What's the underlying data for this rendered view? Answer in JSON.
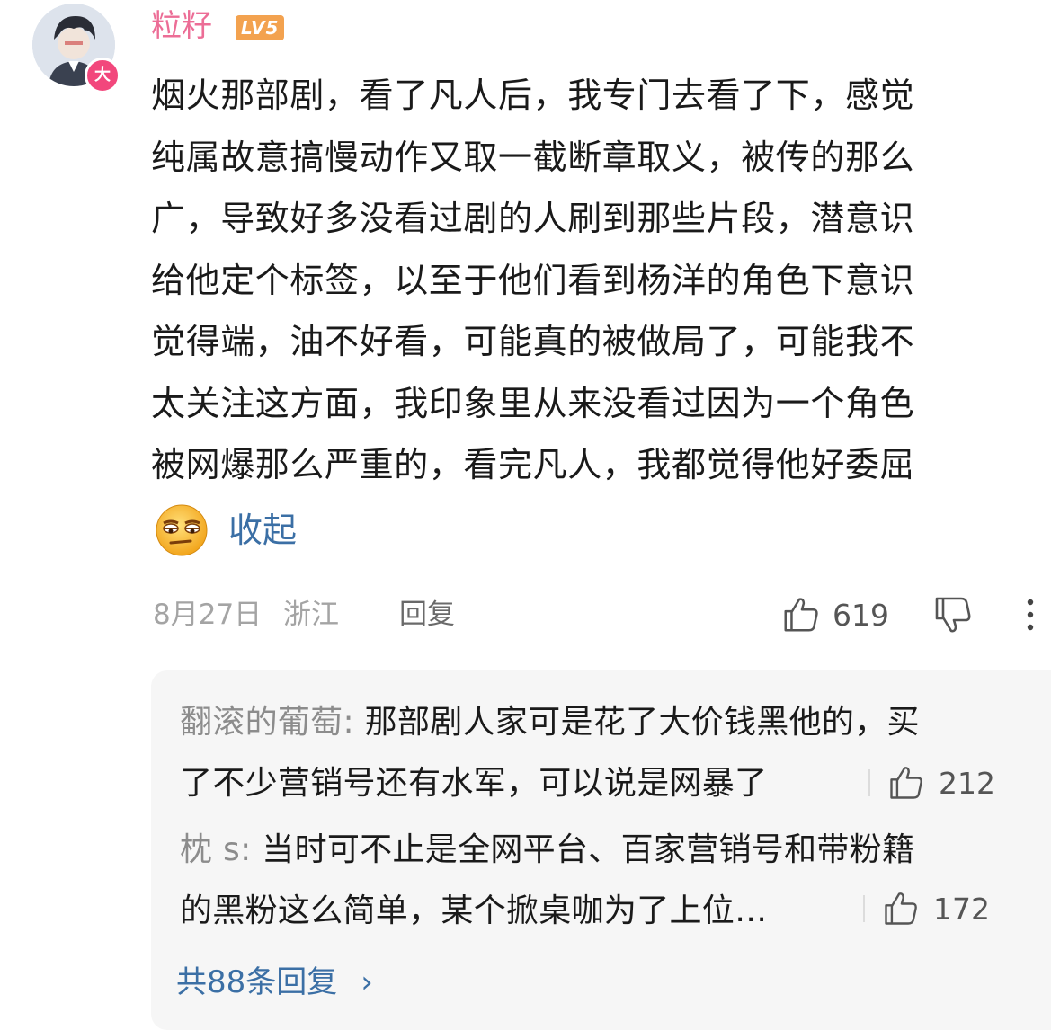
{
  "comment": {
    "username": "粒籽",
    "level": "LV5",
    "vip_badge": "大",
    "lines": [
      "烟火那部剧，看了凡人后，我专门去看了下，感觉",
      "纯属故意搞慢动作又取一截断章取义，被传的那么",
      "广，导致好多没看过剧的人刷到那些片段，潜意识",
      "给他定个标签，以至于他们看到杨洋的角色下意识",
      "觉得端，油不好看，可能真的被做局了，可能我不",
      "太关注这方面，我印象里从来没看过因为一个角色",
      "被网爆那么严重的，看完凡人，我都觉得他好委屈"
    ],
    "emoji": "eye-roll-emoji",
    "collapse_label": "收起",
    "date": "8月27日",
    "location": "浙江",
    "reply_label": "回复",
    "like_count": "619"
  },
  "replies": [
    {
      "author": "翻滚的葡萄:",
      "line1": " 那部剧人家可是花了大价钱黑他的，买",
      "line2": "了不少营销号还有水军，可以说是网暴了",
      "likes": "212"
    },
    {
      "author": "枕 s:",
      "line1": " 当时可不止是全网平台、百家营销号和带粉籍",
      "line2": "的黑粉这么简单，某个掀桌咖为了上位…",
      "likes": "172"
    }
  ],
  "total_replies_label": "共88条回复",
  "colors": {
    "username": "#ec6d96",
    "level_badge": "#f3a24f",
    "vip_badge": "#f2477c",
    "link": "#3b6fa5"
  }
}
